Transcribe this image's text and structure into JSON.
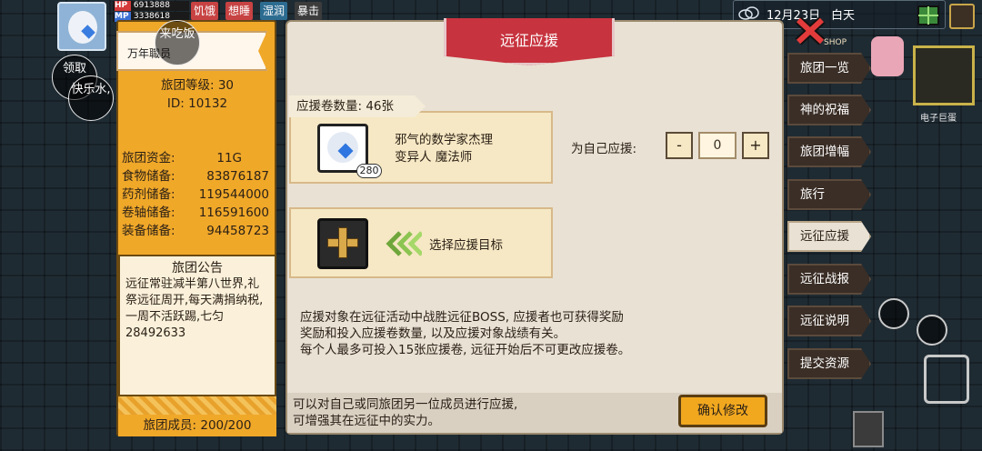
{
  "hud": {
    "hp_label": "HP",
    "hp_value": "6913888",
    "mp_label": "MP",
    "mp_value": "3338618",
    "status_hunger": "饥饿",
    "status_fatigue": "想睡",
    "status_wet": "湿润",
    "status_rage": "暴击",
    "date": "12月23日",
    "time_of_day": "白天",
    "shop_sign": "SHOP",
    "egg_label": "电子巨蛋"
  },
  "bubbles": {
    "b1": "来吃饭",
    "b2": "领取",
    "b3": "快乐水,"
  },
  "guild": {
    "name": "万年職员",
    "level_label": "旅团等级: 30",
    "id_label": "ID: 10132",
    "funds_label": "旅团资金:",
    "funds_value": "11G",
    "food_label": "食物储备:",
    "food_value": "83876187",
    "potion_label": "药剂储备:",
    "potion_value": "119544000",
    "scroll_label": "卷轴储备:",
    "scroll_value": "116591600",
    "equip_label": "装备储备:",
    "equip_value": "94458723",
    "notice_title": "旅团公告",
    "notice_text": "远征常驻减半第八世界,礼祭远征周开,每天满捐纳税,一周不活跃踢,七匀28492633",
    "members": "旅团成员: 200/200"
  },
  "dialog": {
    "title": "远征应援",
    "scroll_count": "应援卷数量: 46张",
    "char_line1": "邪气的数学家杰理",
    "char_line2": "变异人 魔法师",
    "char_level": "280",
    "self_support_label": "为自己应援:",
    "stepper_minus": "-",
    "stepper_value": "0",
    "stepper_plus": "+",
    "select_target": "选择应援目标",
    "desc_line1": "应援对象在远征活动中战胜远征BOSS, 应援者也可获得奖励",
    "desc_line2": "奖励和投入应援卷数量, 以及应援对象战绩有关。",
    "desc_line3": "每个人最多可投入15张应援卷, 远征开始后不可更改应援卷。",
    "footer_line1": "可以对自己或同旅团另一位成员进行应援,",
    "footer_line2": "可增强其在远征中的实力。",
    "confirm": "确认修改"
  },
  "nav": {
    "items": [
      {
        "label": "旅团一览"
      },
      {
        "label": "神的祝福"
      },
      {
        "label": "旅团增幅"
      },
      {
        "label": "旅行"
      },
      {
        "label": "远征应援"
      },
      {
        "label": "远征战报"
      },
      {
        "label": "远征说明"
      },
      {
        "label": "提交资源"
      }
    ],
    "active_index": 4
  }
}
